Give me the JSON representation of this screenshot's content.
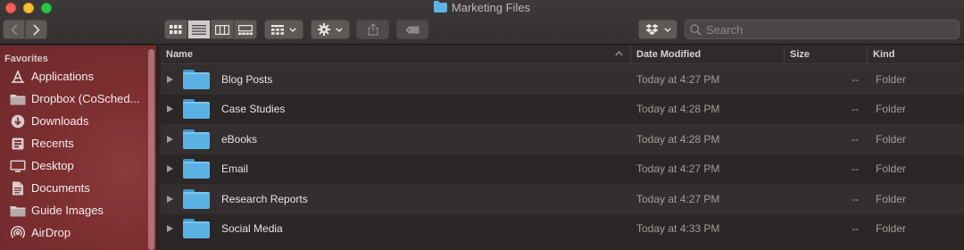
{
  "window": {
    "title": "Marketing Files"
  },
  "toolbar": {
    "search_placeholder": "Search"
  },
  "sidebar": {
    "section_title": "Favorites",
    "items": [
      {
        "label": "Applications",
        "icon": "applications-icon"
      },
      {
        "label": "Dropbox (CoSched...",
        "icon": "folder-icon"
      },
      {
        "label": "Downloads",
        "icon": "downloads-icon"
      },
      {
        "label": "Recents",
        "icon": "recents-icon"
      },
      {
        "label": "Desktop",
        "icon": "desktop-icon"
      },
      {
        "label": "Documents",
        "icon": "documents-icon"
      },
      {
        "label": "Guide Images",
        "icon": "folder-icon"
      },
      {
        "label": "AirDrop",
        "icon": "airdrop-icon"
      }
    ]
  },
  "list": {
    "columns": {
      "name": "Name",
      "date": "Date Modified",
      "size": "Size",
      "kind": "Kind"
    },
    "rows": [
      {
        "name": "Blog Posts",
        "date": "Today at 4:27 PM",
        "size": "--",
        "kind": "Folder"
      },
      {
        "name": "Case Studies",
        "date": "Today at 4:28 PM",
        "size": "--",
        "kind": "Folder"
      },
      {
        "name": "eBooks",
        "date": "Today at 4:28 PM",
        "size": "--",
        "kind": "Folder"
      },
      {
        "name": "Email",
        "date": "Today at 4:27 PM",
        "size": "--",
        "kind": "Folder"
      },
      {
        "name": "Research Reports",
        "date": "Today at 4:27 PM",
        "size": "--",
        "kind": "Folder"
      },
      {
        "name": "Social Media",
        "date": "Today at 4:33 PM",
        "size": "--",
        "kind": "Folder"
      }
    ]
  },
  "colors": {
    "sidebar_accent": "#7d2f31",
    "folder_blue": "#5ab2e4",
    "close": "#fe5f57",
    "minimize": "#febc2e",
    "zoom": "#28c840"
  }
}
